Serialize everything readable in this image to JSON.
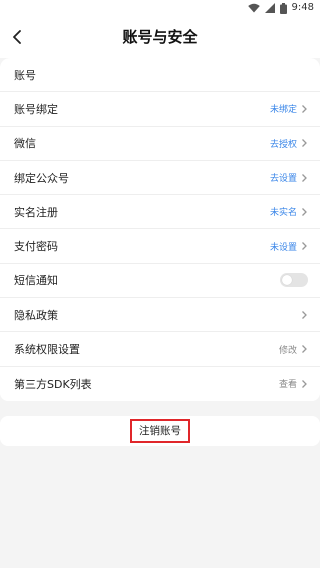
{
  "status_bar": {
    "time": "9:48"
  },
  "header": {
    "title": "账号与安全"
  },
  "settings": {
    "section_label": "账号",
    "items": [
      {
        "label": "账号绑定",
        "value": "未绑定",
        "value_color": "#3a86e8"
      },
      {
        "label": "微信",
        "value": "去授权",
        "value_color": "#3a86e8"
      },
      {
        "label": "绑定公众号",
        "value": "去设置",
        "value_color": "#3a86e8"
      },
      {
        "label": "实名注册",
        "value": "未实名",
        "value_color": "#3a86e8"
      },
      {
        "label": "支付密码",
        "value": "未设置",
        "value_color": "#3a86e8"
      },
      {
        "label": "短信通知",
        "toggle": "off"
      },
      {
        "label": "隐私政策"
      },
      {
        "label": "系统权限设置",
        "value": "修改",
        "value_color": "#888888"
      },
      {
        "label": "第三方SDK列表",
        "value": "查看",
        "value_color": "#888888"
      }
    ]
  },
  "account": {
    "cancel_label": "注销账号",
    "highlight_color": "#e0262a"
  }
}
